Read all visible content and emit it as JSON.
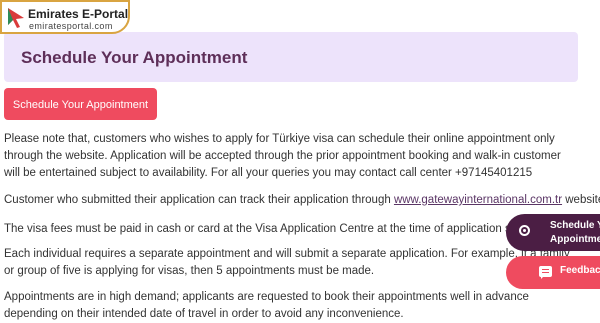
{
  "logo": {
    "title": "Emirates E-Portal",
    "subtitle": "emiratesportal.com",
    "icon": "cursor-arrow-icon",
    "colors": {
      "border": "#d9a441",
      "arrow_primary": "#d93b3b",
      "arrow_secondary": "#2e8b57"
    }
  },
  "header": {
    "title": "Schedule Your Appointment",
    "background": "#ede3fb",
    "color": "#5e2f59"
  },
  "primary_button": {
    "label": "Schedule Your Appointment",
    "color": "#ef4b5f"
  },
  "paragraphs": {
    "p1": "Please note that, customers who wishes to apply for Türkiye visa can schedule their online appointment only through the website. Application will be accepted through the prior appointment booking and walk-in customer will be entertained subject to availability. For all your queries you may contact call center +97145401215",
    "p2_before": "Customer who submitted their application can track their application through ",
    "p2_link": "www.gatewayinternational.com.tr",
    "p2_after": " website.",
    "p3": "The visa fees must be paid in cash or card at the Visa Application Centre at the time of application submission.",
    "p4": "Each individual requires a separate appointment and will submit a separate application. For example, if a family or group of five is applying for visas, then 5 appointments must be made.",
    "p5": "Appointments are in high demand; applicants are requested to book their appointments well in advance depending on their intended date of travel in order to avoid any inconvenience."
  },
  "floating": {
    "schedule_line1": "Schedule Your",
    "schedule_line2": "Appointment",
    "schedule_icon": "target-icon",
    "schedule_color": "#4b1e44",
    "feedback_label": "Feedback",
    "feedback_icon": "feedback-icon",
    "feedback_color": "#ef4b5f"
  }
}
